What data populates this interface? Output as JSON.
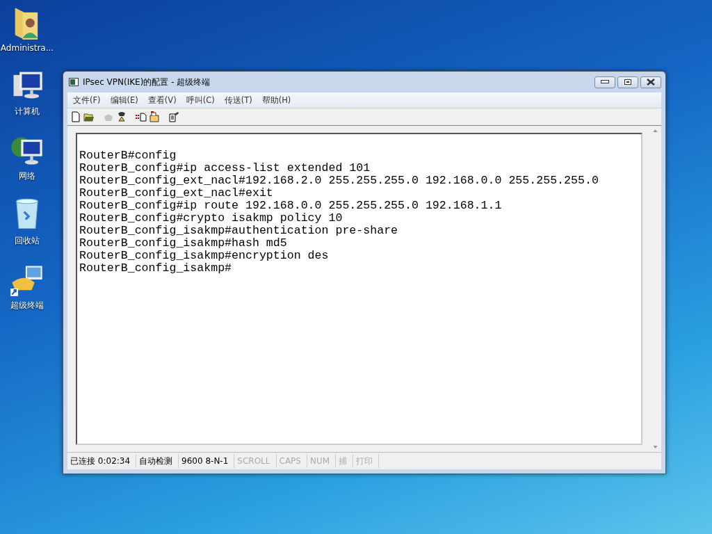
{
  "desktop_icons": [
    {
      "kind": "user-folder",
      "label": "Administra..."
    },
    {
      "kind": "computer",
      "label": "计算机"
    },
    {
      "kind": "network",
      "label": "网络"
    },
    {
      "kind": "recycle",
      "label": "回收站"
    },
    {
      "kind": "terminal",
      "label": "超级终端"
    }
  ],
  "window": {
    "title": "IPsec VPN(IKE)的配置 - 超级终端"
  },
  "menu": [
    "文件(F)",
    "编辑(E)",
    "查看(V)",
    "呼叫(C)",
    "传送(T)",
    "帮助(H)"
  ],
  "toolbar": [
    {
      "kind": "new",
      "disabled": false
    },
    {
      "kind": "open",
      "disabled": false
    },
    {
      "kind": "call",
      "disabled": true
    },
    {
      "kind": "disconnect",
      "disabled": false
    },
    {
      "kind": "send",
      "disabled": false
    },
    {
      "kind": "receive",
      "disabled": false
    },
    {
      "kind": "properties",
      "disabled": false
    }
  ],
  "terminal_lines": [
    "RouterB#config",
    "RouterB_config#ip access-list extended 101",
    "RouterB_config_ext_nacl#192.168.2.0 255.255.255.0 192.168.0.0 255.255.255.0",
    "RouterB_config_ext_nacl#exit",
    "RouterB_config#ip route 192.168.0.0 255.255.255.0 192.168.1.1",
    "RouterB_config#crypto isakmp policy 10",
    "RouterB_config_isakmp#authentication pre-share",
    "RouterB_config_isakmp#hash md5",
    "RouterB_config_isakmp#encryption des",
    "RouterB_config_isakmp#"
  ],
  "status_bar": [
    {
      "text": "已连接 0:02:34",
      "active": true
    },
    {
      "text": "自动检测",
      "active": true
    },
    {
      "text": "9600 8-N-1",
      "active": true
    },
    {
      "text": "SCROLL",
      "active": false
    },
    {
      "text": "CAPS",
      "active": false
    },
    {
      "text": "NUM",
      "active": false
    },
    {
      "text": "捕",
      "active": false
    },
    {
      "text": "打印",
      "active": false
    }
  ]
}
